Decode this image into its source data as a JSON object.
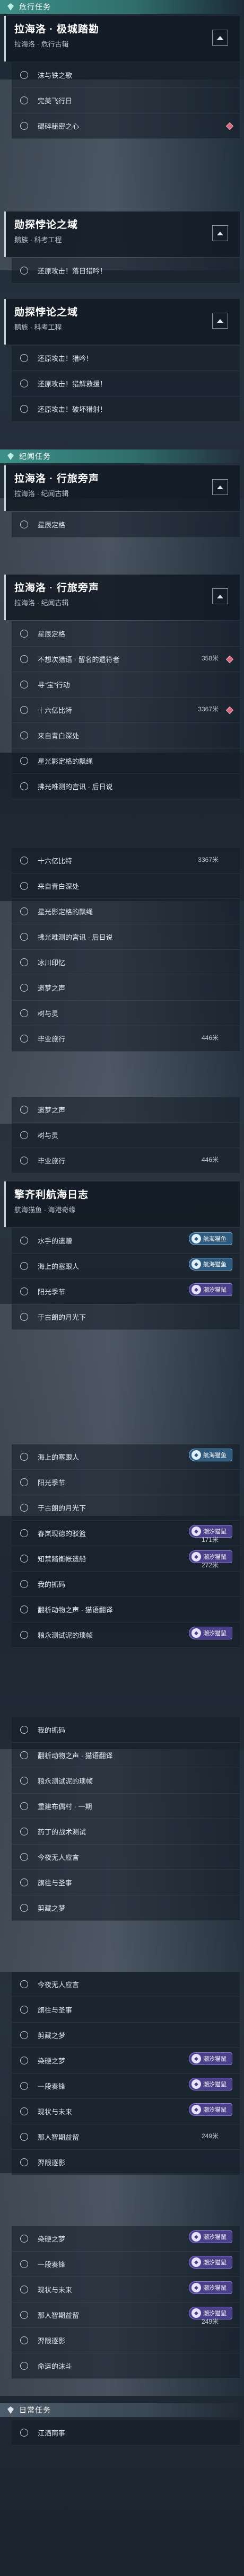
{
  "s1": {
    "category": "危行任务",
    "title": "拉海洛 · 极城踏勘",
    "subtitle": "拉海洛 · 危行古辑",
    "items": [
      "沫与铁之歌",
      "完美飞行日",
      "碾碎秘密之心"
    ]
  },
  "s2": {
    "title": "勋探悖论之域",
    "subtitle": "鹅族 · 科考工程",
    "items": [
      "还原攻击！落日猎吟！"
    ]
  },
  "s3": {
    "title": "勋探悖论之域",
    "subtitle": "鹅族 · 科考工程",
    "items": [
      "还原攻击！猎吟！",
      "还原攻击！猎解救援！",
      "还原攻击！破坏猎射！"
    ]
  },
  "s4": {
    "category": "纪闻任务",
    "title": "拉海洛 · 行旅旁声",
    "subtitle": "拉海洛 · 纪闻古辑",
    "items": [
      "星辰定格"
    ]
  },
  "s5": {
    "title": "拉海洛 · 行旅旁声",
    "subtitle": "拉海洛 · 纪闻古辑",
    "items": [
      {
        "label": "星辰定格"
      },
      {
        "label": "不想次猎语 · 留名的遗符者",
        "dist": "358米"
      },
      {
        "label": "寻“宝”行动"
      },
      {
        "label": "十六亿比特",
        "dist": "3367米"
      },
      {
        "label": "来自青白深处"
      },
      {
        "label": "星光影定格的飘绳"
      },
      {
        "label": "拂光唯测的宫讯 · 后日说"
      }
    ]
  },
  "s6": {
    "items": [
      {
        "label": "十六亿比特",
        "dist": "3367米"
      },
      {
        "label": "来自青白深处"
      },
      {
        "label": "星光影定格的飘绳"
      },
      {
        "label": "拂光唯测的宫讯 · 后日说"
      },
      {
        "label": "冰川印忆"
      },
      {
        "label": "遗梦之声"
      },
      {
        "label": "树与灵"
      },
      {
        "label": "毕业旅行",
        "dist": "446米"
      }
    ]
  },
  "s7": {
    "items": [
      {
        "label": "遗梦之声"
      },
      {
        "label": "树与灵"
      },
      {
        "label": "毕业旅行",
        "dist": "446米"
      }
    ]
  },
  "s8": {
    "title": "擎齐利航海日志",
    "subtitle": "航海猫鱼 · 海港奇缘",
    "badge_blue": "航海猫鱼",
    "badge_purple": "潮汐猫鼠",
    "items": [
      {
        "label": "水手的遗赠"
      },
      {
        "label": "海上的塞跟人"
      },
      {
        "label": "阳光季节"
      },
      {
        "label": "于古朗的月光下"
      }
    ]
  },
  "s9": {
    "items": [
      {
        "label": "海上的塞跟人",
        "badge": "blue"
      },
      {
        "label": "阳光季节"
      },
      {
        "label": "于古朗的月光下"
      },
      {
        "label": "春岚现德的驳篮",
        "badge": "purple",
        "dist": "171米"
      },
      {
        "label": "知禁踏衡帐遗船",
        "badge": "purple",
        "dist": "272米"
      },
      {
        "label": "我的抓码"
      },
      {
        "label": "翻析动物之声 · 猫语翻译"
      },
      {
        "label": "粮永测试泥的琐帧",
        "badge": "purple"
      }
    ]
  },
  "s10": {
    "items": [
      {
        "label": "我的抓码"
      },
      {
        "label": "翻析动物之声 · 猫语翻译"
      },
      {
        "label": "粮永测试泥的琐帧"
      },
      {
        "label": "重建布偶村 · 一期"
      },
      {
        "label": "药丁的战术测试"
      },
      {
        "label": "今夜无人应言"
      },
      {
        "label": "旗往与圣事"
      },
      {
        "label": "剪藏之梦"
      }
    ]
  },
  "s11": {
    "items": [
      {
        "label": "今夜无人应言"
      },
      {
        "label": "旗往与圣事"
      },
      {
        "label": "剪藏之梦"
      },
      {
        "label": "染硬之梦",
        "badge": "purple"
      },
      {
        "label": "一段奏锋",
        "badge": "purple"
      },
      {
        "label": "现状与未来",
        "badge": "purple"
      },
      {
        "label": "那人智期益留",
        "dist": "249米"
      },
      {
        "label": "羿限逐影"
      }
    ]
  },
  "s12": {
    "category": "日常任务",
    "items": [
      {
        "label": "染硬之梦",
        "badge": "purple"
      },
      {
        "label": "一段奏锋",
        "badge": "purple"
      },
      {
        "label": "现状与未来",
        "badge": "purple"
      },
      {
        "label": "那人智期益留",
        "badge": "purple",
        "dist": "249米"
      },
      {
        "label": "羿限逐影"
      },
      {
        "label": "命运的沫斗"
      }
    ],
    "daily_item": "江洒南事"
  }
}
